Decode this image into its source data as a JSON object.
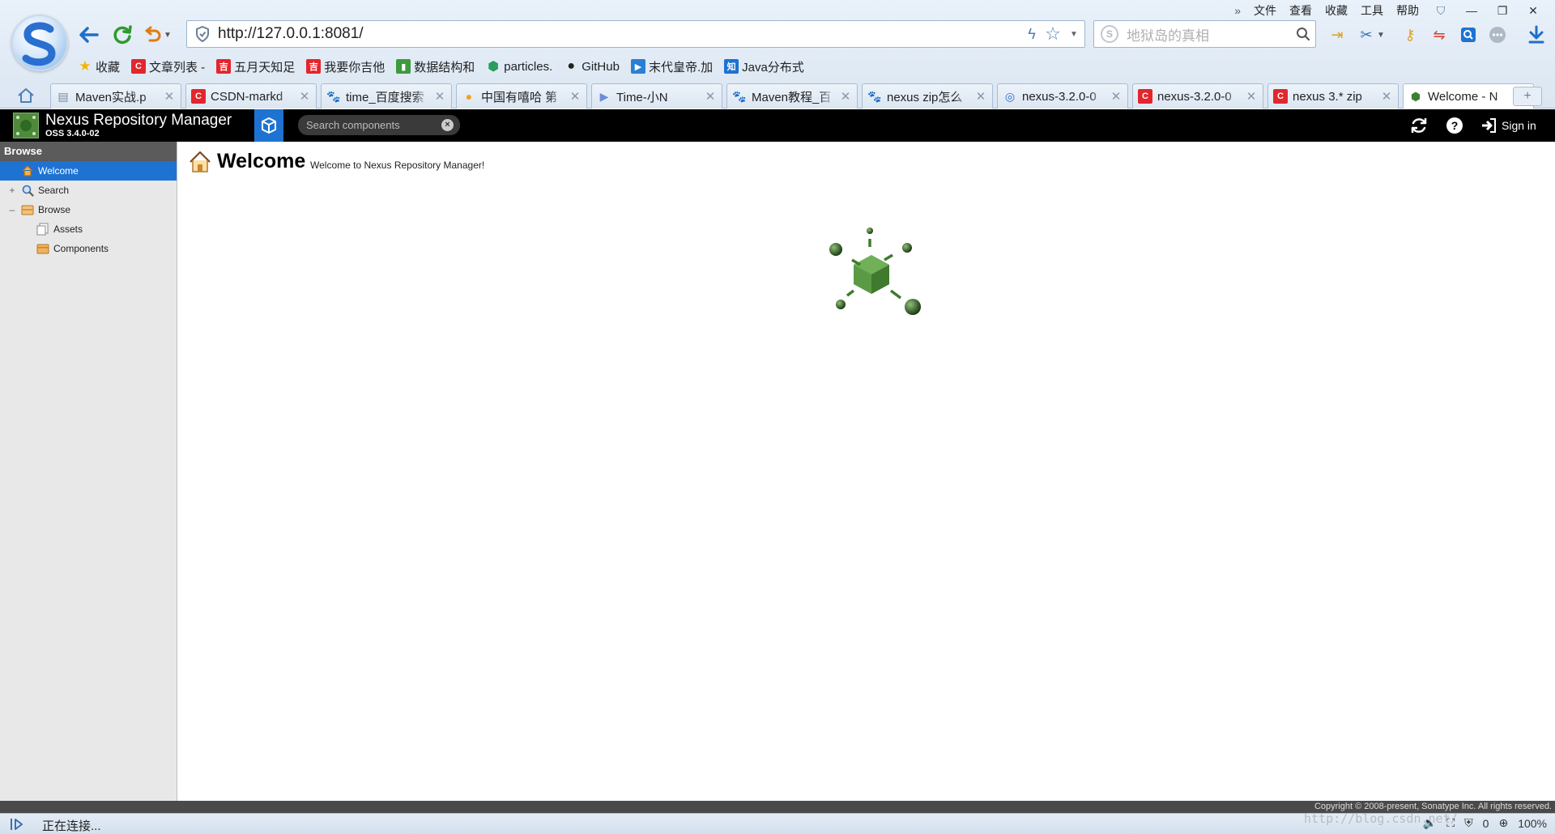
{
  "browser": {
    "address_url": "http://127.0.0.1:8081/",
    "search_placeholder": "地狱岛的真相",
    "menu": [
      "文件",
      "查看",
      "收藏",
      "工具",
      "帮助"
    ],
    "bookmarks": [
      {
        "label": "收藏",
        "icon": "star-icon",
        "color": "#f5b400"
      },
      {
        "label": "文章列表 -",
        "icon": "csdn-icon",
        "color": "#e3262c"
      },
      {
        "label": "五月天知足",
        "icon": "ji-icon",
        "color": "#e3262c"
      },
      {
        "label": "我要你吉他",
        "icon": "ji-icon",
        "color": "#e3262c"
      },
      {
        "label": "数据结构和",
        "icon": "book-icon",
        "color": "#3d9a3d"
      },
      {
        "label": "particles.",
        "icon": "hex-icon",
        "color": "#2a9c5e"
      },
      {
        "label": "GitHub",
        "icon": "github-icon",
        "color": "#222222"
      },
      {
        "label": "末代皇帝.加",
        "icon": "play-icon",
        "color": "#2a7fd4"
      },
      {
        "label": "Java分布式",
        "icon": "zhi-icon",
        "color": "#1e73d2"
      }
    ],
    "tabs": [
      {
        "title": "Maven实战.p",
        "icon": "doc-icon",
        "color": "#7a8aa0"
      },
      {
        "title": "CSDN-markd",
        "icon": "csdn-icon",
        "color": "#e3262c"
      },
      {
        "title": "time_百度搜索",
        "icon": "baidu-icon",
        "color": "#2932e1"
      },
      {
        "title": "中国有嘻哈 第",
        "icon": "mango-icon",
        "color": "#f3a31b"
      },
      {
        "title": "Time-小N",
        "icon": "video-icon",
        "color": "#6a8cd8"
      },
      {
        "title": "Maven教程_百",
        "icon": "baidu-icon",
        "color": "#2932e1"
      },
      {
        "title": "nexus zip怎么",
        "icon": "baidu-icon",
        "color": "#2932e1"
      },
      {
        "title": "nexus-3.2.0-0",
        "icon": "globe-icon",
        "color": "#2a6fd4"
      },
      {
        "title": "nexus-3.2.0-0",
        "icon": "csdn-icon",
        "color": "#e3262c"
      },
      {
        "title": "nexus 3.* zip",
        "icon": "csdn-icon",
        "color": "#e3262c"
      },
      {
        "title": "Welcome - N",
        "icon": "nexus-icon",
        "color": "#3f7f32"
      }
    ],
    "new_tab_label": "+",
    "status_text": "正在连接...",
    "status_count": "0",
    "zoom": "100%",
    "watermark": "http://blog.csdn.net/"
  },
  "nexus": {
    "app_title": "Nexus Repository Manager",
    "version": "OSS 3.4.0-02",
    "search_placeholder": "Search components",
    "signin_label": "Sign in",
    "sidebar_title": "Browse",
    "tree": [
      {
        "label": "Welcome",
        "icon": "home-icon"
      },
      {
        "label": "Search",
        "icon": "search-icon",
        "expander": "+"
      },
      {
        "label": "Browse",
        "icon": "database-icon",
        "expander": "–"
      },
      {
        "label": "Assets",
        "icon": "assets-icon"
      },
      {
        "label": "Components",
        "icon": "components-icon"
      }
    ],
    "welcome_title": "Welcome",
    "welcome_subtitle": "Welcome to Nexus Repository Manager!",
    "copyright": "Copyright © 2008-present, Sonatype Inc. All rights reserved."
  }
}
